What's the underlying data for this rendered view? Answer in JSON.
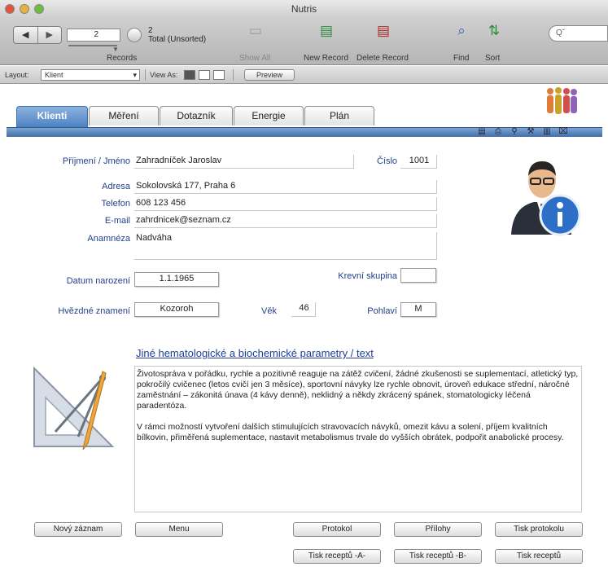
{
  "window": {
    "title": "Nutris"
  },
  "toolbar": {
    "record_value": "2",
    "record_label": "Records",
    "total_count": "2",
    "total_label": "Total (Unsorted)",
    "show_all": "Show All",
    "new_record": "New Record",
    "delete_record": "Delete Record",
    "find": "Find",
    "sort": "Sort",
    "search_placeholder": "Qˇ"
  },
  "layoutbar": {
    "layout_label": "Layout:",
    "layout_value": "Klient",
    "view_as_label": "View As:",
    "preview": "Preview"
  },
  "tabs": [
    "Klienti",
    "Měření",
    "Dotazník",
    "Energie",
    "Plán"
  ],
  "form": {
    "name_label": "Příjmení / Jméno",
    "name_value": "Zahradníček Jaroslav",
    "number_label": "Číslo",
    "number_value": "1001",
    "address_label": "Adresa",
    "address_value": "Sokolovská 177, Praha 6",
    "phone_label": "Telefon",
    "phone_value": "608 123 456",
    "email_label": "E-mail",
    "email_value": "zahrdnicek@seznam.cz",
    "anamnesis_label": "Anamnéza",
    "anamnesis_value": "Nadváha",
    "dob_label": "Datum narození",
    "dob_value": "1.1.1965",
    "blood_label": "Krevní skupina",
    "blood_value": "",
    "zodiac_label": "Hvězdné znamení",
    "zodiac_value": "Kozoroh",
    "age_label": "Věk",
    "age_value": "46",
    "sex_label": "Pohlaví",
    "sex_value": "M"
  },
  "notes": {
    "heading": "Jiné hematologické a biochemické parametry / text",
    "paragraph1": "Životospráva v pořádku, rychle a pozitivně reaguje na zátěž cvičení, žádné zkušenosti se suplementací, atletický typ, pokročilý cvičenec (letos cvičí jen 3 měsíce), sportovní návyky lze rychle obnovit, úroveň edukace střední, náročné zaměstnání – zákonitá únava (4 kávy denně), neklidný a někdy zkrácený spánek, stomatologicky léčená paradentóza.",
    "paragraph2": "V rámci možností vytvoření dalších stimulujících stravovacích návyků, omezit kávu a solení, příjem kvalitních bílkovin, přiměřená suplementace, nastavit metabolismus trvale do vyšších obrátek, podpořit anabolické procesy."
  },
  "buttons": {
    "new_entry": "Nový záznam",
    "menu": "Menu",
    "protocol": "Protokol",
    "attachments": "Přílohy",
    "print_protocol": "Tisk protokolu",
    "print_recipes_a": "Tisk receptů -A-",
    "print_recipes_b": "Tisk receptů -B-",
    "print_recipes": "Tisk receptů"
  },
  "colors": {
    "tab_active": "#4b82c4",
    "label_blue": "#233f8d",
    "link_blue": "#1f3d99"
  }
}
